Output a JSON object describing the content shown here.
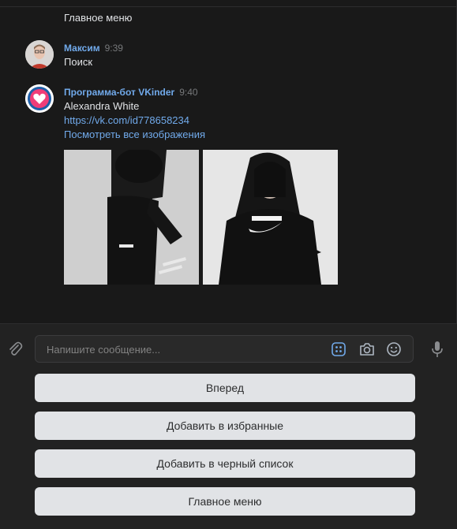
{
  "messages": {
    "previous_text": "Главное меню",
    "user_message": {
      "author": "Максим",
      "time": "9:39",
      "text": "Поиск"
    },
    "bot_message": {
      "author": "Программа-бот VKinder",
      "time": "9:40",
      "name": "Alexandra White",
      "profile_link": "https://vk.com/id778658234",
      "all_photos_link": "Посмотреть все изображения"
    }
  },
  "composer": {
    "placeholder": "Напишите сообщение...",
    "icons": [
      "paperclip-icon",
      "bot-keyboard-icon",
      "camera-icon",
      "emoji-icon",
      "microphone-icon"
    ]
  },
  "keyboard": {
    "buttons": [
      "Вперед",
      "Добавить в избранные",
      "Добавить в черный список",
      "Главное меню"
    ]
  },
  "colors": {
    "background": "#191919",
    "link": "#71aaeb",
    "button_bg": "#e1e3e6",
    "accent_bot_icon": "#71aaeb"
  }
}
